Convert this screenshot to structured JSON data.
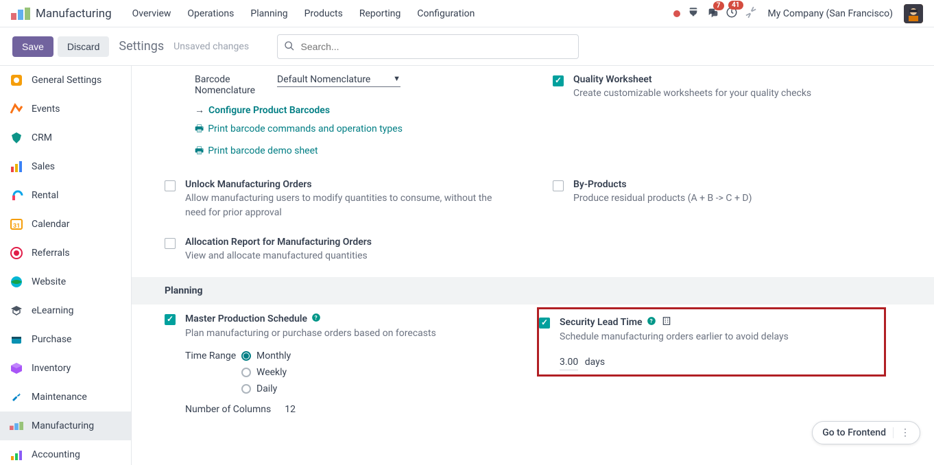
{
  "topnav": {
    "app_name": "Manufacturing",
    "links": [
      "Overview",
      "Operations",
      "Planning",
      "Products",
      "Reporting",
      "Configuration"
    ],
    "messages_badge": "7",
    "activities_badge": "41",
    "company": "My Company (San Francisco)"
  },
  "actionbar": {
    "save": "Save",
    "discard": "Discard",
    "title": "Settings",
    "status": "Unsaved changes",
    "search_placeholder": "Search..."
  },
  "sidebar": {
    "items": [
      {
        "label": "General Settings"
      },
      {
        "label": "Events"
      },
      {
        "label": "CRM"
      },
      {
        "label": "Sales"
      },
      {
        "label": "Rental"
      },
      {
        "label": "Calendar"
      },
      {
        "label": "Referrals"
      },
      {
        "label": "Website"
      },
      {
        "label": "eLearning"
      },
      {
        "label": "Purchase"
      },
      {
        "label": "Inventory"
      },
      {
        "label": "Maintenance"
      },
      {
        "label": "Manufacturing"
      },
      {
        "label": "Accounting"
      }
    ]
  },
  "barcode": {
    "label": "Barcode Nomenclature",
    "value": "Default Nomenclature",
    "configure": "Configure Product Barcodes",
    "print_commands": "Print barcode commands and operation types",
    "print_demo": "Print barcode demo sheet"
  },
  "quality": {
    "title": "Quality Worksheet",
    "desc": "Create customizable worksheets for your quality checks"
  },
  "unlock": {
    "title": "Unlock Manufacturing Orders",
    "desc": "Allow manufacturing users to modify quantities to consume, without the need for prior approval"
  },
  "byproducts": {
    "title": "By-Products",
    "desc": "Produce residual products (A + B -> C + D)"
  },
  "allocation": {
    "title": "Allocation Report for Manufacturing Orders",
    "desc": "View and allocate manufactured quantities"
  },
  "planning": {
    "header": "Planning",
    "mps": {
      "title": "Master Production Schedule",
      "desc": "Plan manufacturing or purchase orders based on forecasts",
      "time_range_label": "Time Range",
      "monthly": "Monthly",
      "weekly": "Weekly",
      "daily": "Daily",
      "num_columns_label": "Number of Columns",
      "num_columns_value": "12"
    },
    "slt": {
      "title": "Security Lead Time",
      "desc": "Schedule manufacturing orders earlier to avoid delays",
      "value": "3.00",
      "unit": "days"
    }
  },
  "frontend": "Go to Frontend"
}
